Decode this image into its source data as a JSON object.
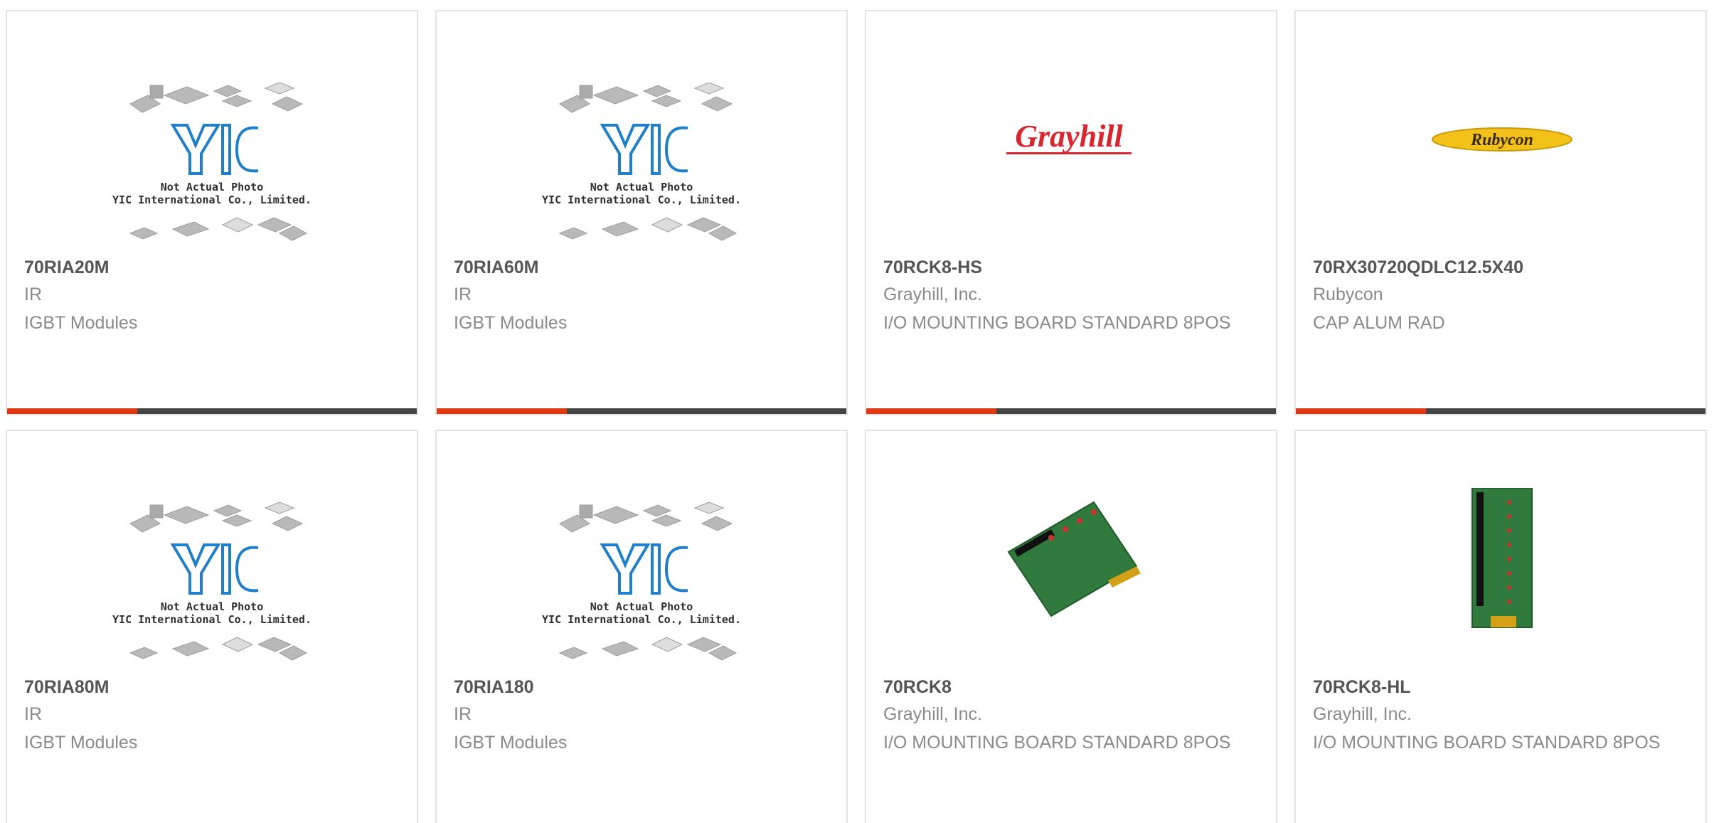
{
  "products": [
    {
      "part": "70RIA20M",
      "manufacturer": "IR",
      "description": "IGBT Modules",
      "image": "placeholder",
      "placeholder_line1": "Not Actual Photo",
      "placeholder_line2": "YIC International Co., Limited."
    },
    {
      "part": "70RIA60M",
      "manufacturer": "IR",
      "description": "IGBT Modules",
      "image": "placeholder",
      "placeholder_line1": "Not Actual Photo",
      "placeholder_line2": "YIC International Co., Limited."
    },
    {
      "part": "70RCK8-HS",
      "manufacturer": "Grayhill, Inc.",
      "description": "I/O MOUNTING BOARD STANDARD 8POS",
      "image": "grayhill-logo",
      "logo_text": "Grayhill"
    },
    {
      "part": "70RX30720QDLC12.5X40",
      "manufacturer": "Rubycon",
      "description": "CAP ALUM RAD",
      "image": "rubycon-logo",
      "logo_text": "Rubycon"
    },
    {
      "part": "70RIA80M",
      "manufacturer": "IR",
      "description": "IGBT Modules",
      "image": "placeholder",
      "placeholder_line1": "Not Actual Photo",
      "placeholder_line2": "YIC International Co., Limited."
    },
    {
      "part": "70RIA180",
      "manufacturer": "IR",
      "description": "IGBT Modules",
      "image": "placeholder",
      "placeholder_line1": "Not Actual Photo",
      "placeholder_line2": "YIC International Co., Limited."
    },
    {
      "part": "70RCK8",
      "manufacturer": "Grayhill, Inc.",
      "description": "I/O MOUNTING BOARD STANDARD 8POS",
      "image": "pcb-board-angled"
    },
    {
      "part": "70RCK8-HL",
      "manufacturer": "Grayhill, Inc.",
      "description": "I/O MOUNTING BOARD STANDARD 8POS",
      "image": "pcb-board-vertical"
    }
  ],
  "colors": {
    "accent": "#e03a12",
    "bar": "#444444",
    "title": "#555555",
    "text": "#8a8a8a",
    "yic_blue": "#1f7fc9",
    "grayhill_red": "#d9262e",
    "rubycon_yellow": "#f2c11a"
  }
}
